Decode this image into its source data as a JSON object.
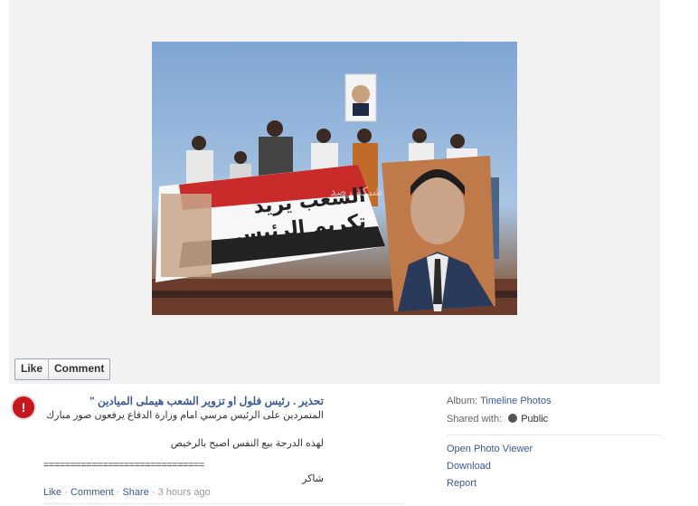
{
  "actions": {
    "like": "Like",
    "comment": "Comment"
  },
  "photo": {
    "banner_line1": "الشعب يريد",
    "banner_line2": "تكريم الرئيس",
    "watermark": "شبكة رصد"
  },
  "post": {
    "author_title": "تحذير . رئيس فلول او تزوير الشعب هيملى الميادين \"",
    "avatar_text": "!",
    "line1": "المتمردين على الرئيس مرسي امام وزارة الدفاع يرفعون صور مبارك",
    "line2": "لهذه الدرجة بيع النفس اصبح بالرخيص",
    "separator": "==============================",
    "signoff": "شاكر",
    "meta": {
      "like": "Like",
      "comment": "Comment",
      "share": "Share",
      "time": "3 hours ago",
      "dot": "·"
    }
  },
  "sidebar": {
    "album_label": "Album:",
    "album_value": "Timeline Photos",
    "shared_label": "Shared with:",
    "shared_value": "Public",
    "links": [
      "Open Photo Viewer",
      "Download",
      "Report"
    ]
  }
}
